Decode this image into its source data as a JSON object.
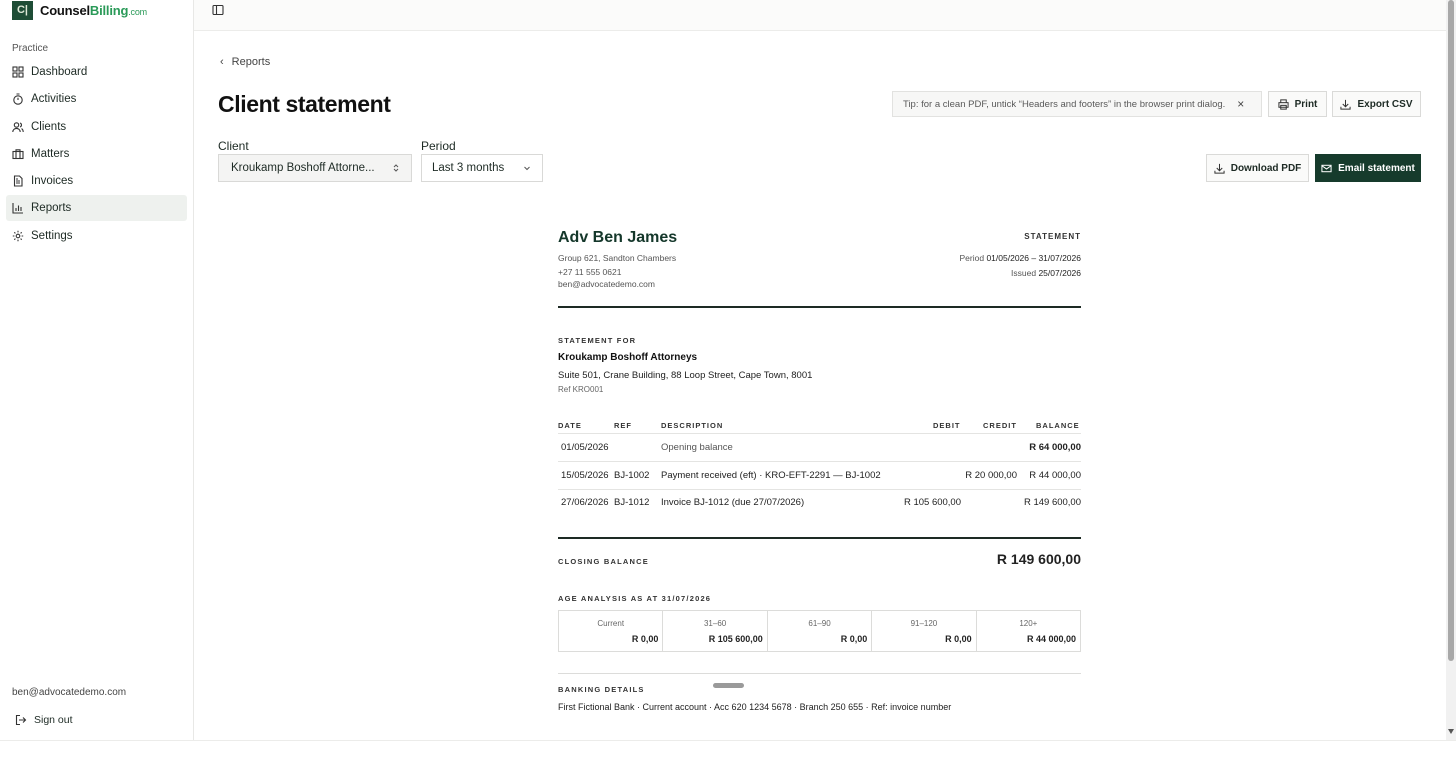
{
  "app": {
    "logo_mark": "C|",
    "logo_name": "Counsel",
    "logo_accent": "Billing",
    "logo_tld": ".com",
    "brand_color": "#163b2c"
  },
  "sidebar": {
    "section": "Practice",
    "items": [
      {
        "label": "Dashboard",
        "icon": "grid-icon"
      },
      {
        "label": "Activities",
        "icon": "timer-icon"
      },
      {
        "label": "Clients",
        "icon": "users-icon"
      },
      {
        "label": "Matters",
        "icon": "briefcase-icon"
      },
      {
        "label": "Invoices",
        "icon": "document-icon"
      },
      {
        "label": "Reports",
        "icon": "bar-chart-icon",
        "active": true
      },
      {
        "label": "Settings",
        "icon": "gear-icon"
      }
    ],
    "user_email": "ben@advocatedemo.com",
    "signout_label": "Sign out"
  },
  "header": {
    "breadcrumb": "Reports",
    "title": "Client statement",
    "tip": "Tip: for a clean PDF, untick “Headers and footers” in the browser print dialog.",
    "print_label": "Print",
    "export_label": "Export CSV",
    "download_label": "Download PDF",
    "email_label": "Email statement"
  },
  "filters": {
    "client_label": "Client",
    "client_value": "Kroukamp Boshoff Attorne...",
    "period_label": "Period",
    "period_value": "Last 3 months"
  },
  "statement": {
    "advocate": "Adv Ben James",
    "address": "Group 621, Sandton Chambers",
    "phone": "+27 11 555 0621",
    "email": "ben@advocatedemo.com",
    "label": "STATEMENT",
    "period_label": "Period",
    "period_value": "01/05/2026 – 31/07/2026",
    "issued_label": "Issued",
    "issued_value": "25/07/2026",
    "for_label": "STATEMENT FOR",
    "client_name": "Kroukamp Boshoff Attorneys",
    "client_address": "Suite 501, Crane Building, 88 Loop Street, Cape Town, 8001",
    "client_ref": "Ref KRO001",
    "columns": [
      "DATE",
      "REF",
      "DESCRIPTION",
      "DEBIT",
      "CREDIT",
      "BALANCE"
    ],
    "rows": [
      {
        "date": "01/05/2026",
        "ref": "",
        "description": "Opening balance",
        "debit": "",
        "credit": "",
        "balance": "R 64 000,00"
      },
      {
        "date": "15/05/2026",
        "ref": "BJ-1002",
        "description": "Payment received (eft) · KRO-EFT-2291 — BJ-1002",
        "debit": "",
        "credit": "R 20 000,00",
        "balance": "R 44 000,00"
      },
      {
        "date": "27/06/2026",
        "ref": "BJ-1012",
        "description": "Invoice BJ-1012 (due 27/07/2026)",
        "debit": "R 105 600,00",
        "credit": "",
        "balance": "R 149 600,00"
      }
    ],
    "closing_label": "CLOSING BALANCE",
    "closing_value": "R 149 600,00",
    "age_label": "AGE ANALYSIS AS AT 31/07/2026",
    "age": [
      {
        "bucket": "Current",
        "value": "R 0,00"
      },
      {
        "bucket": "31–60",
        "value": "R 105 600,00"
      },
      {
        "bucket": "61–90",
        "value": "R 0,00"
      },
      {
        "bucket": "91–120",
        "value": "R 0,00"
      },
      {
        "bucket": "120+",
        "value": "R 44 000,00"
      }
    ],
    "banking_label": "BANKING DETAILS",
    "banking_text": "First Fictional Bank · Current account · Acc 620 1234 5678 · Branch 250 655 · Ref: invoice number"
  }
}
